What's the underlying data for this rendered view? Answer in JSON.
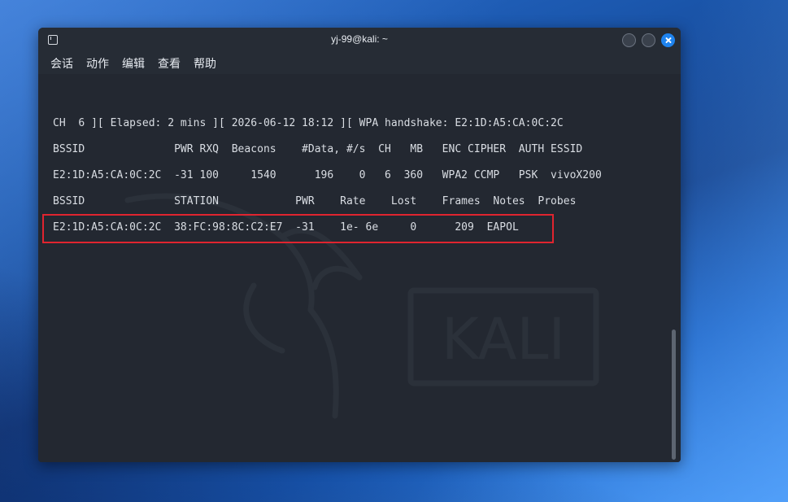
{
  "window": {
    "title": "yj-99@kali: ~"
  },
  "menu": {
    "items": [
      {
        "label": "会话"
      },
      {
        "label": "动作"
      },
      {
        "label": "编辑"
      },
      {
        "label": "查看"
      },
      {
        "label": "帮助"
      }
    ]
  },
  "terminal": {
    "lines": [
      "CH  6 ][ Elapsed: 2 mins ][ 2026-06-12 18:12 ][ WPA handshake: E2:1D:A5:CA:0C:2C",
      "BSSID              PWR RXQ  Beacons    #Data, #/s  CH   MB   ENC CIPHER  AUTH ESSID",
      "E2:1D:A5:CA:0C:2C  -31 100     1540      196    0   6  360   WPA2 CCMP   PSK  vivoX200",
      "BSSID              STATION            PWR    Rate    Lost    Frames  Notes  Probes",
      "E2:1D:A5:CA:0C:2C  38:FC:98:8C:C2:E7  -31    1e- 6e     0      209  EAPOL"
    ]
  },
  "watermark": {
    "text": "KALI"
  },
  "colors": {
    "terminal_bg": "#232831",
    "text": "#d9dde3",
    "highlight": "#e0242f",
    "close_button": "#1e83ee"
  }
}
